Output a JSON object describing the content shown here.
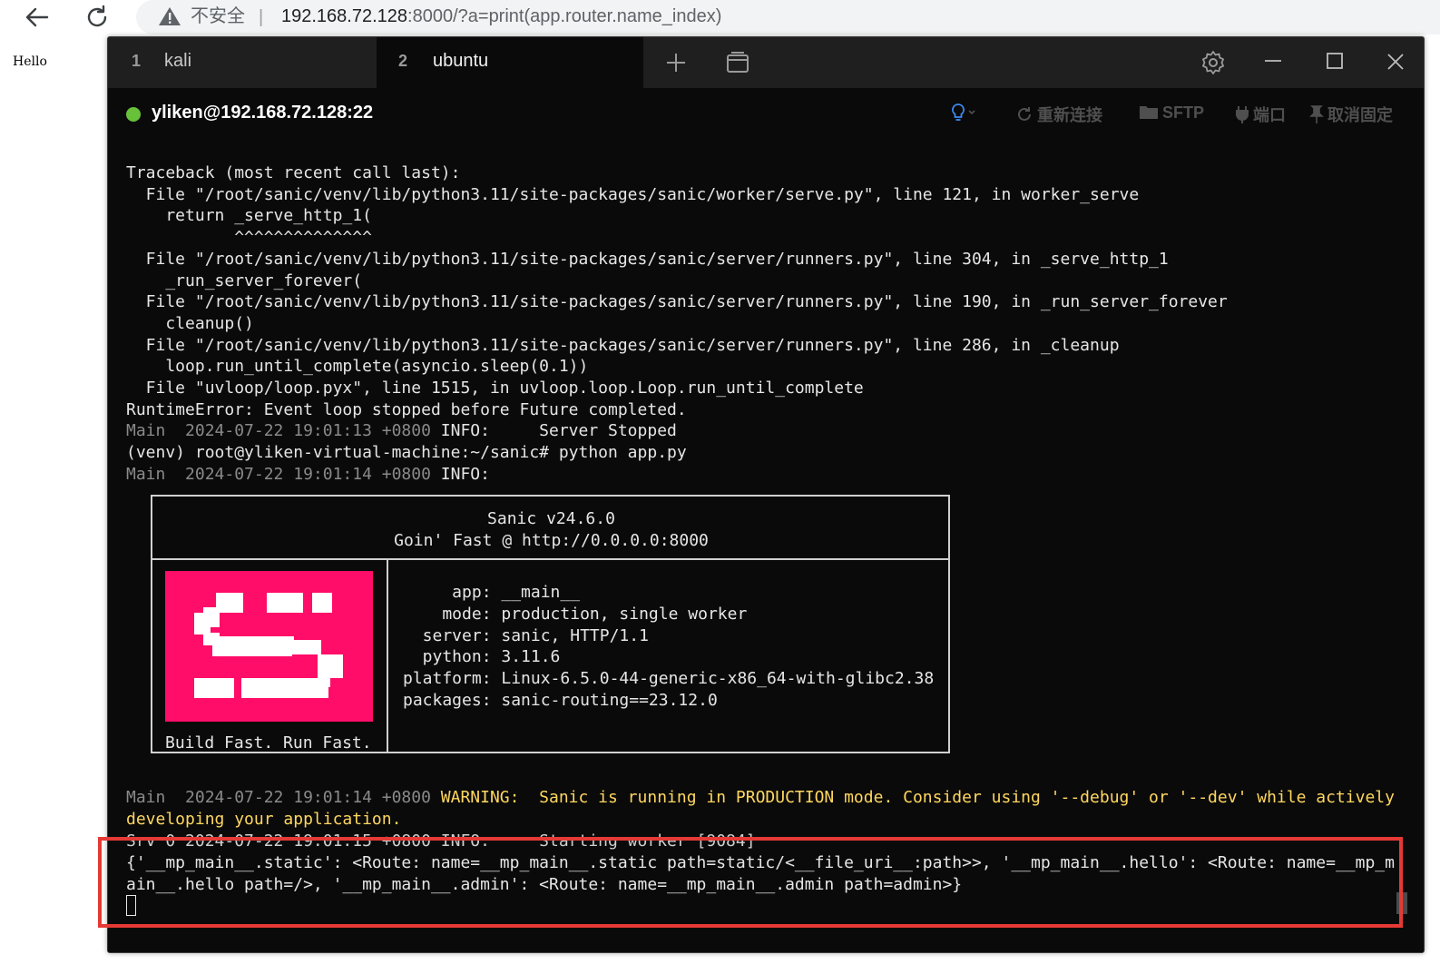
{
  "browser": {
    "insecure_label": "不安全",
    "separator": "|",
    "url_host": "192.168.72.128",
    "url_rest": ":8000/?a=print(app.router.name_index)"
  },
  "page": {
    "body_text": "Hello"
  },
  "tabs": [
    {
      "number": "1",
      "label": "kali"
    },
    {
      "number": "2",
      "label": "ubuntu"
    }
  ],
  "session": {
    "host": "yliken@192.168.72.128:22",
    "status_color": "#67c23a",
    "tools": {
      "reconnect": "重新连接",
      "sftp": "SFTP",
      "port": "端口",
      "unpin": "取消固定"
    }
  },
  "terminal": {
    "traceback": "Traceback (most recent call last):\n  File \"/root/sanic/venv/lib/python3.11/site-packages/sanic/worker/serve.py\", line 121, in worker_serve\n    return _serve_http_1(\n           ^^^^^^^^^^^^^^\n  File \"/root/sanic/venv/lib/python3.11/site-packages/sanic/server/runners.py\", line 304, in _serve_http_1\n    _run_server_forever(\n  File \"/root/sanic/venv/lib/python3.11/site-packages/sanic/server/runners.py\", line 190, in _run_server_forever\n    cleanup()\n  File \"/root/sanic/venv/lib/python3.11/site-packages/sanic/server/runners.py\", line 286, in _cleanup\n    loop.run_until_complete(asyncio.sleep(0.1))\n  File \"uvloop/loop.pyx\", line 1515, in uvloop.loop.Loop.run_until_complete\nRuntimeError: Event loop stopped before Future completed.",
    "stopped_prefix": "Main  2024-07-22 19:01:13 +0800 ",
    "stopped_msg": "INFO:     Server Stopped",
    "prompt_line": "(venv) root@yliken-virtual-machine:~/sanic# python app.py",
    "info_prefix": "Main  2024-07-22 19:01:14 +0800 ",
    "info_msg": "INFO:",
    "banner_title": "Sanic v24.6.0",
    "banner_subtitle": "Goin' Fast @ http://0.0.0.0:8000",
    "banner_app": "     app: __main__",
    "banner_mode": "    mode: production, single worker",
    "banner_server": "  server: sanic, HTTP/1.1",
    "banner_python": "  python: 3.11.6",
    "banner_platform": "platform: Linux-6.5.0-44-generic-x86_64-with-glibc2.38",
    "banner_packages": "packages: sanic-routing==23.12.0",
    "banner_tagline": "Build Fast. Run Fast.",
    "warning_prefix": "Main  2024-07-22 19:01:14 +0800 ",
    "warning_msg": "WARNING:  Sanic is running in PRODUCTION mode. Consider using '--debug' or '--dev' while actively developing your application.",
    "partial_line": "Srv 0 2024-07-22 19:01:15 +0800 INFO:     Starting worker [9084]",
    "route_output": "{'__mp_main__.static': <Route: name=__mp_main__.static path=static/<__file_uri__:path>>, '__mp_main__.hello': <Route: name=__mp_main__.hello path=/>, '__mp_main__.admin': <Route: name=__mp_main__.admin path=admin>}"
  },
  "colors": {
    "highlight": "#e53935",
    "warning": "#ffd75f",
    "sanic_pink": "#ff0d68"
  }
}
